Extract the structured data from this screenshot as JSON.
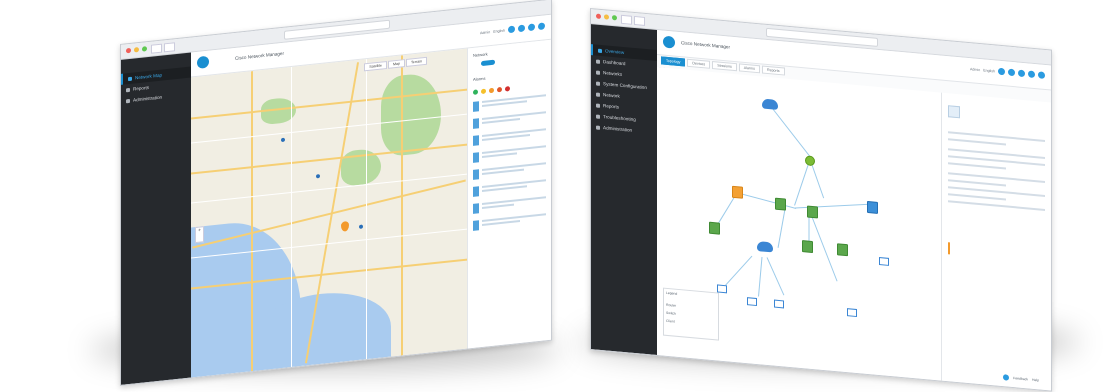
{
  "left_window": {
    "url": "",
    "sidebar": {
      "items": [
        {
          "label": "Network Map",
          "active": true
        },
        {
          "label": "Reports",
          "active": false
        },
        {
          "label": "Administration",
          "active": false
        }
      ]
    },
    "header": {
      "brand_lines": [
        "",
        ""
      ],
      "title": "Cisco Network Manager",
      "account": "Admin",
      "account_menu": "English"
    },
    "map": {
      "view_options": [
        "Satellite",
        "Map",
        "Terrain"
      ],
      "zoom_label": "+"
    },
    "panel": {
      "title": "Network",
      "description": "",
      "section_label": "Alarms",
      "list_count": 8
    },
    "colors": {
      "accent": "#1a8fd1",
      "sidebar": "#26292d",
      "map_land": "#f1eee3",
      "ocean": "#a9cbef",
      "park": "#b7dba0",
      "road": "#f6cf74"
    }
  },
  "right_window": {
    "sidebar": {
      "items": [
        {
          "label": "Overview",
          "active": true
        },
        {
          "label": "Dashboard",
          "active": false
        },
        {
          "label": "Networks",
          "active": false
        },
        {
          "label": "System Configuration",
          "active": false
        },
        {
          "label": "Network",
          "active": false
        },
        {
          "label": "Reports",
          "active": false
        },
        {
          "label": "Troubleshooting",
          "active": false
        },
        {
          "label": "Administration",
          "active": false
        }
      ]
    },
    "header": {
      "title": "Cisco Network Manager",
      "account": "Admin",
      "account_menu": "English"
    },
    "tabs": [
      "Topology",
      "Devices",
      "Sessions",
      "Alarms",
      "Reports"
    ],
    "detail": {
      "title": "",
      "subtitle": "",
      "link_text": "",
      "section_label": ""
    },
    "legend": {
      "title": "Legend",
      "items": [
        "Router",
        "Switch",
        "Client"
      ]
    },
    "footer": {
      "left": "Feedback",
      "right": "Help"
    },
    "colors": {
      "accent": "#1a8fd1",
      "node_green": "#5ba74c",
      "node_orange": "#f3a135",
      "node_blue": "#3c8fd8",
      "cloud": "#3b86d4",
      "link": "#9ccbea"
    }
  }
}
